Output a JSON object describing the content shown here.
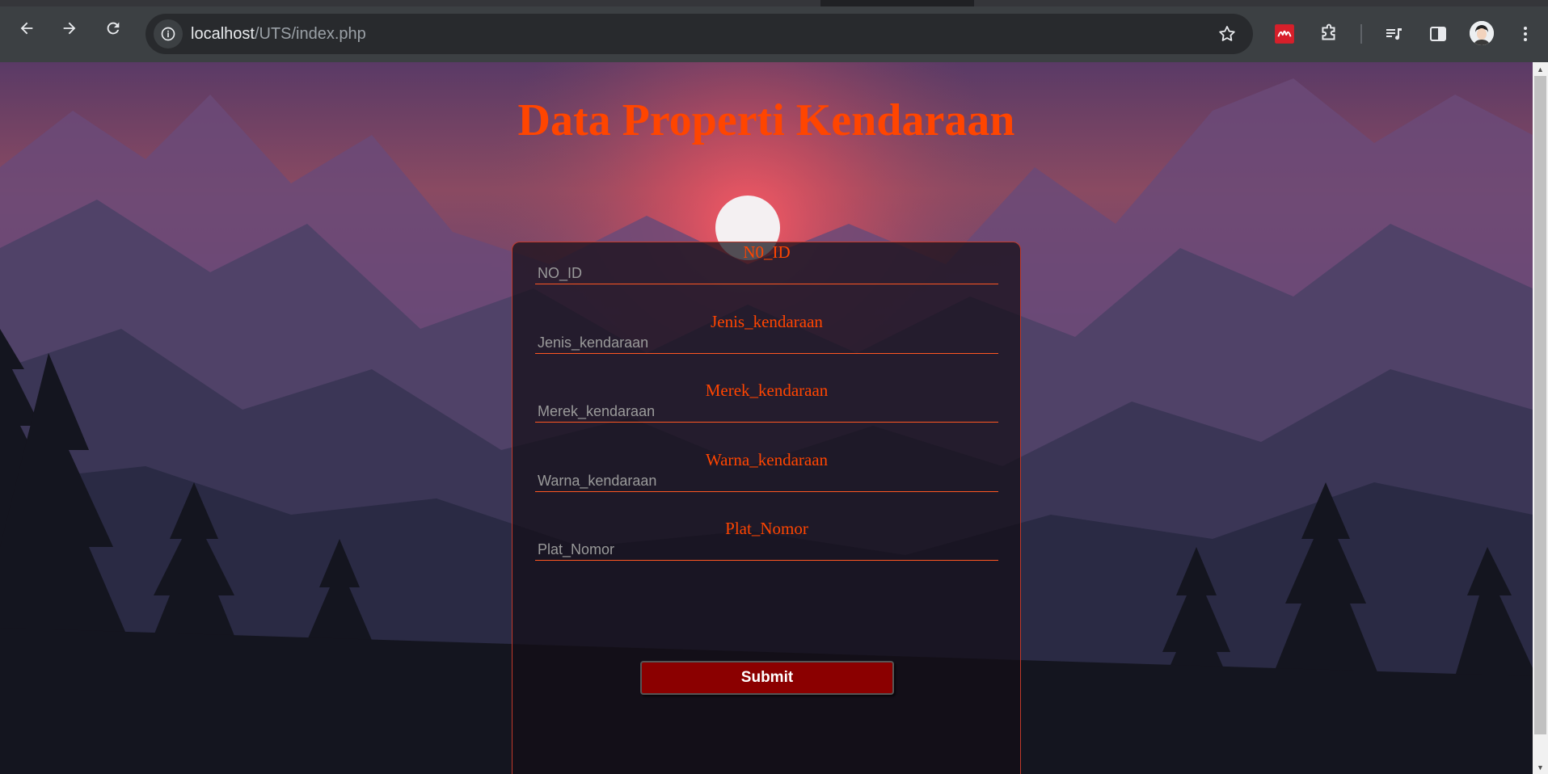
{
  "browser": {
    "url_host": "localhost",
    "url_path": "/UTS/index.php"
  },
  "page": {
    "title": "Data Properti Kendaraan"
  },
  "form": {
    "fields": [
      {
        "label": "N0_ID",
        "placeholder": "NO_ID"
      },
      {
        "label": "Jenis_kendaraan",
        "placeholder": "Jenis_kendaraan"
      },
      {
        "label": "Merek_kendaraan",
        "placeholder": "Merek_kendaraan"
      },
      {
        "label": "Warna_kendaraan",
        "placeholder": "Warna_kendaraan"
      },
      {
        "label": "Plat_Nomor",
        "placeholder": "Plat_Nomor"
      }
    ],
    "submit_label": "Submit"
  },
  "colors": {
    "title": "#ff4500",
    "label": "#ff4500",
    "submit_bg": "#8b0000",
    "input_border": "#ff5722"
  }
}
